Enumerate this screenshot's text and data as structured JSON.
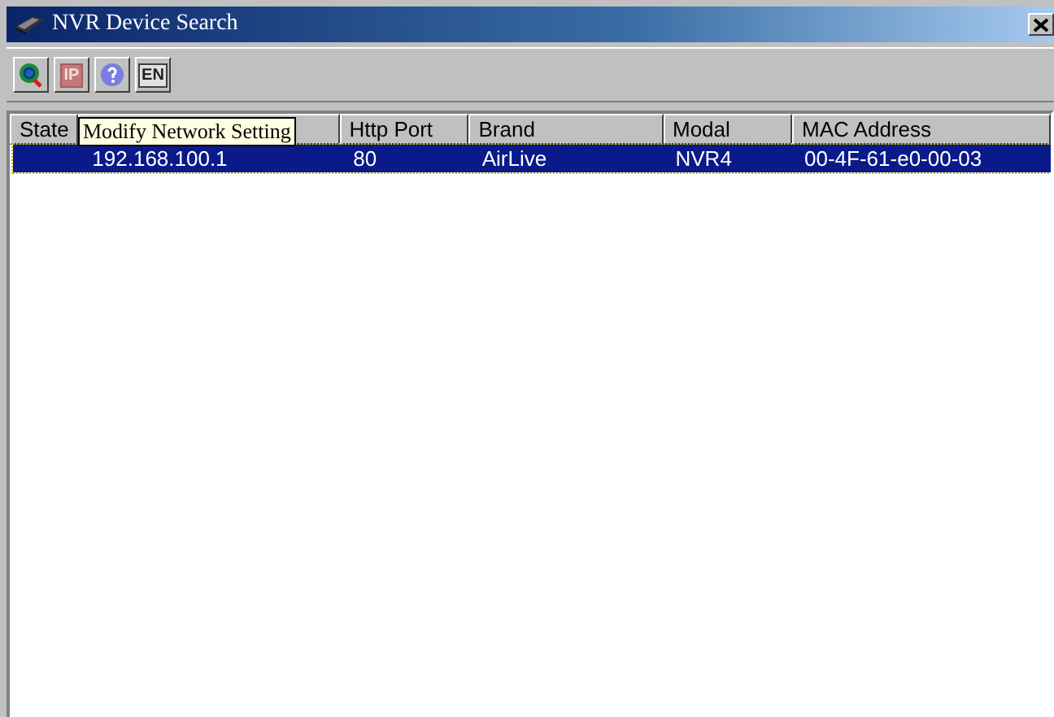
{
  "window": {
    "title": "NVR Device Search"
  },
  "toolbar": [
    {
      "kind": "search",
      "disabled": false
    },
    {
      "kind": "text",
      "label": "IP",
      "disabled": true
    },
    {
      "kind": "help",
      "disabled": false
    },
    {
      "kind": "text",
      "label": "EN",
      "disabled": false
    }
  ],
  "tooltip": "Modify Network Setting",
  "table": {
    "columns": [
      {
        "label": "State"
      },
      {},
      {
        "label": "Http Port"
      },
      {
        "label": "Brand"
      },
      {
        "label": "Modal"
      },
      {
        "label": "MAC Address"
      }
    ],
    "rows": [
      {
        "selected": true,
        "cells": [
          "",
          "192.168.100.1",
          "80",
          "AirLive",
          "NVR4",
          "00-4F-61-e0-00-03"
        ]
      }
    ]
  }
}
